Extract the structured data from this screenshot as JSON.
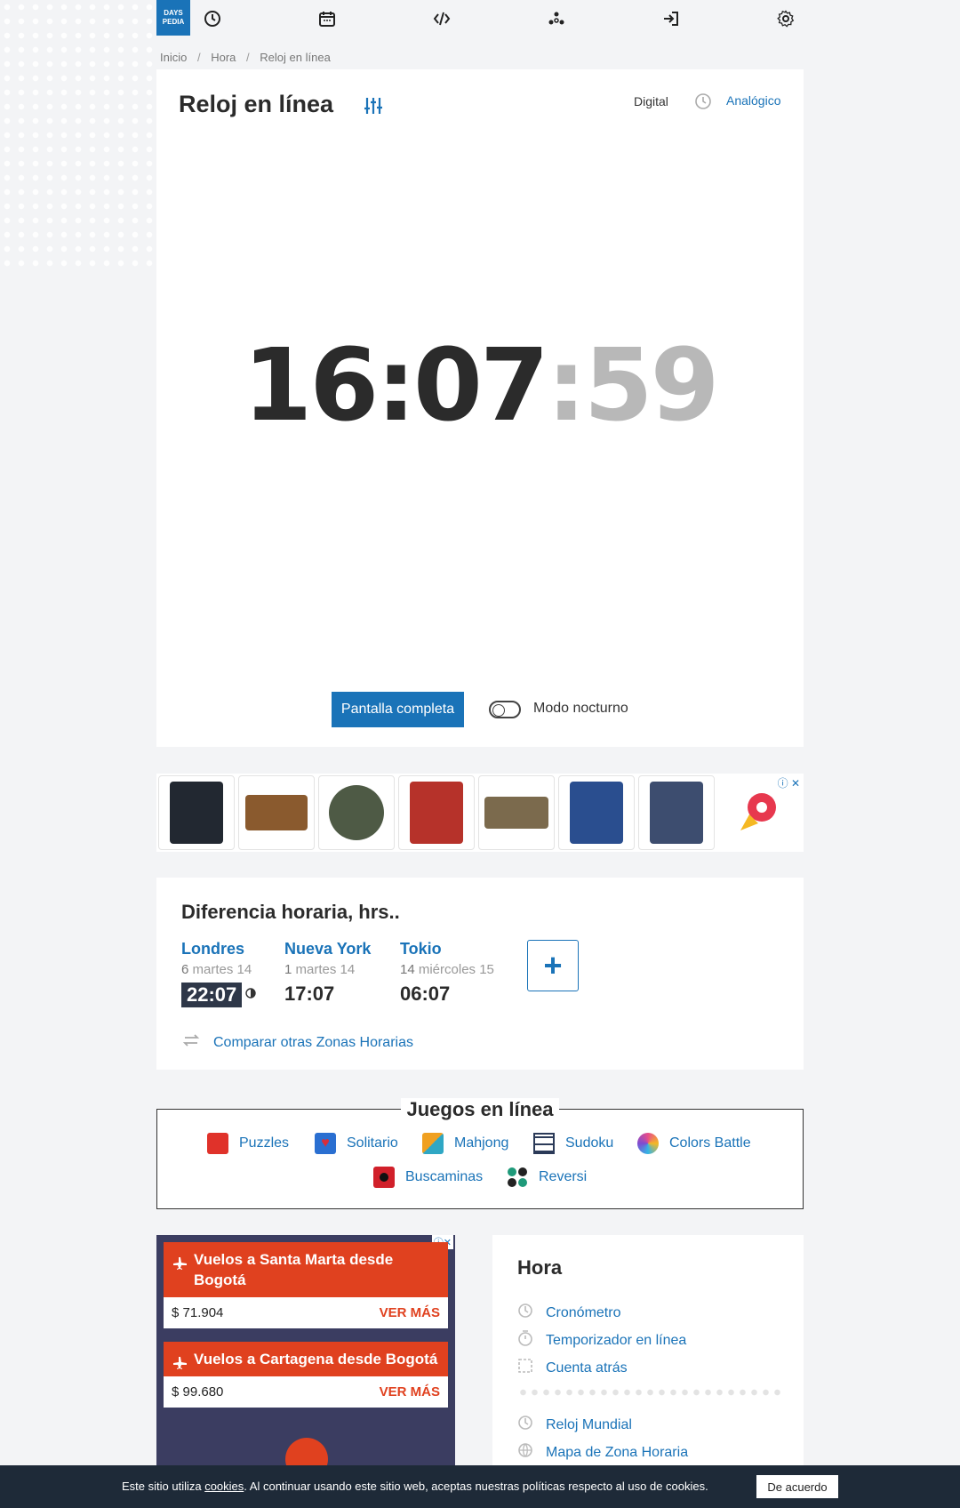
{
  "nav": {
    "logo_line1": "DAYS",
    "logo_line2": "PEDIA",
    "icons": [
      "clock-icon",
      "calendar-icon",
      "code-icon",
      "network-icon",
      "login-icon",
      "gear-icon"
    ]
  },
  "breadcrumb": {
    "items": [
      "Inicio",
      "Hora",
      "Reloj en línea"
    ],
    "separator": "/"
  },
  "clock_card": {
    "title": "Reloj en línea",
    "mode_digital": "Digital",
    "mode_analog": "Analógico",
    "time_hm": "16:07",
    "time_sec": ":59",
    "fullscreen_label": "Pantalla completa",
    "night_mode_label": "Modo nocturno",
    "night_mode_on": false
  },
  "ad_strip": {
    "choice_label": "ⓘ ✕",
    "items": [
      {
        "name": "tablet",
        "color": "#222831"
      },
      {
        "name": "toy-truck",
        "color": "#8a5a2e"
      },
      {
        "name": "watch",
        "color": "#4e5a45"
      },
      {
        "name": "spiderman-movie",
        "color": "#b6322a"
      },
      {
        "name": "dinosaur-toy",
        "color": "#7b6a4d"
      },
      {
        "name": "fifa-game",
        "color": "#2a4e8f"
      },
      {
        "name": "iphone-13",
        "color": "#3d4d6f"
      },
      {
        "name": "rocket-logo",
        "color": "#e7384e"
      }
    ]
  },
  "time_diff": {
    "title": "Diferencia horaria, hrs..",
    "cities": [
      {
        "name": "Londres",
        "offset": "6",
        "date": "martes 14",
        "time": "22:07",
        "current": true
      },
      {
        "name": "Nueva York",
        "offset": "1",
        "date": "martes 14",
        "time": "17:07",
        "current": false
      },
      {
        "name": "Tokio",
        "offset": "14",
        "date": "miércoles 15",
        "time": "06:07",
        "current": false
      }
    ],
    "add_label": "+",
    "compare_label": "Comparar otras Zonas Horarias"
  },
  "games": {
    "title": "Juegos en línea",
    "items": [
      {
        "label": "Puzzles",
        "color": "#e0322a"
      },
      {
        "label": "Solitario",
        "color": "#d92d3a"
      },
      {
        "label": "Mahjong",
        "color": "#f0a020"
      },
      {
        "label": "Sudoku",
        "color": "#2b3a58"
      },
      {
        "label": "Colors Battle",
        "color": "#e84d8a"
      },
      {
        "label": "Buscaminas",
        "color": "#d1202a"
      },
      {
        "label": "Reversi",
        "color": "#1f9a7a"
      }
    ]
  },
  "flights_ad": {
    "choice_label": "ⓘ✕",
    "offers": [
      {
        "title": "Vuelos a Santa Marta desde Bogotá",
        "price": "$ 71.904",
        "cta": "VER MÁS"
      },
      {
        "title": "Vuelos a Cartagena desde Bogotá",
        "price": "$ 99.680",
        "cta": "VER MÁS"
      }
    ]
  },
  "hour_card": {
    "title": "Hora",
    "links_top": [
      "Cronómetro",
      "Temporizador en línea",
      "Cuenta atrás"
    ],
    "links_bottom": [
      "Reloj Mundial",
      "Mapa de Zona Horaria"
    ]
  },
  "cookie": {
    "text_before": "Este sitio utiliza ",
    "link": "cookies",
    "text_after": ". Al continuar usando este sitio web, aceptas nuestras políticas respecto al uso de cookies.",
    "button": "De acuerdo"
  },
  "colors": {
    "accent": "#1a73b8",
    "dark": "#2b2b2b",
    "flight_orange": "#e0411f",
    "cookie_bg": "#1e2a38"
  }
}
